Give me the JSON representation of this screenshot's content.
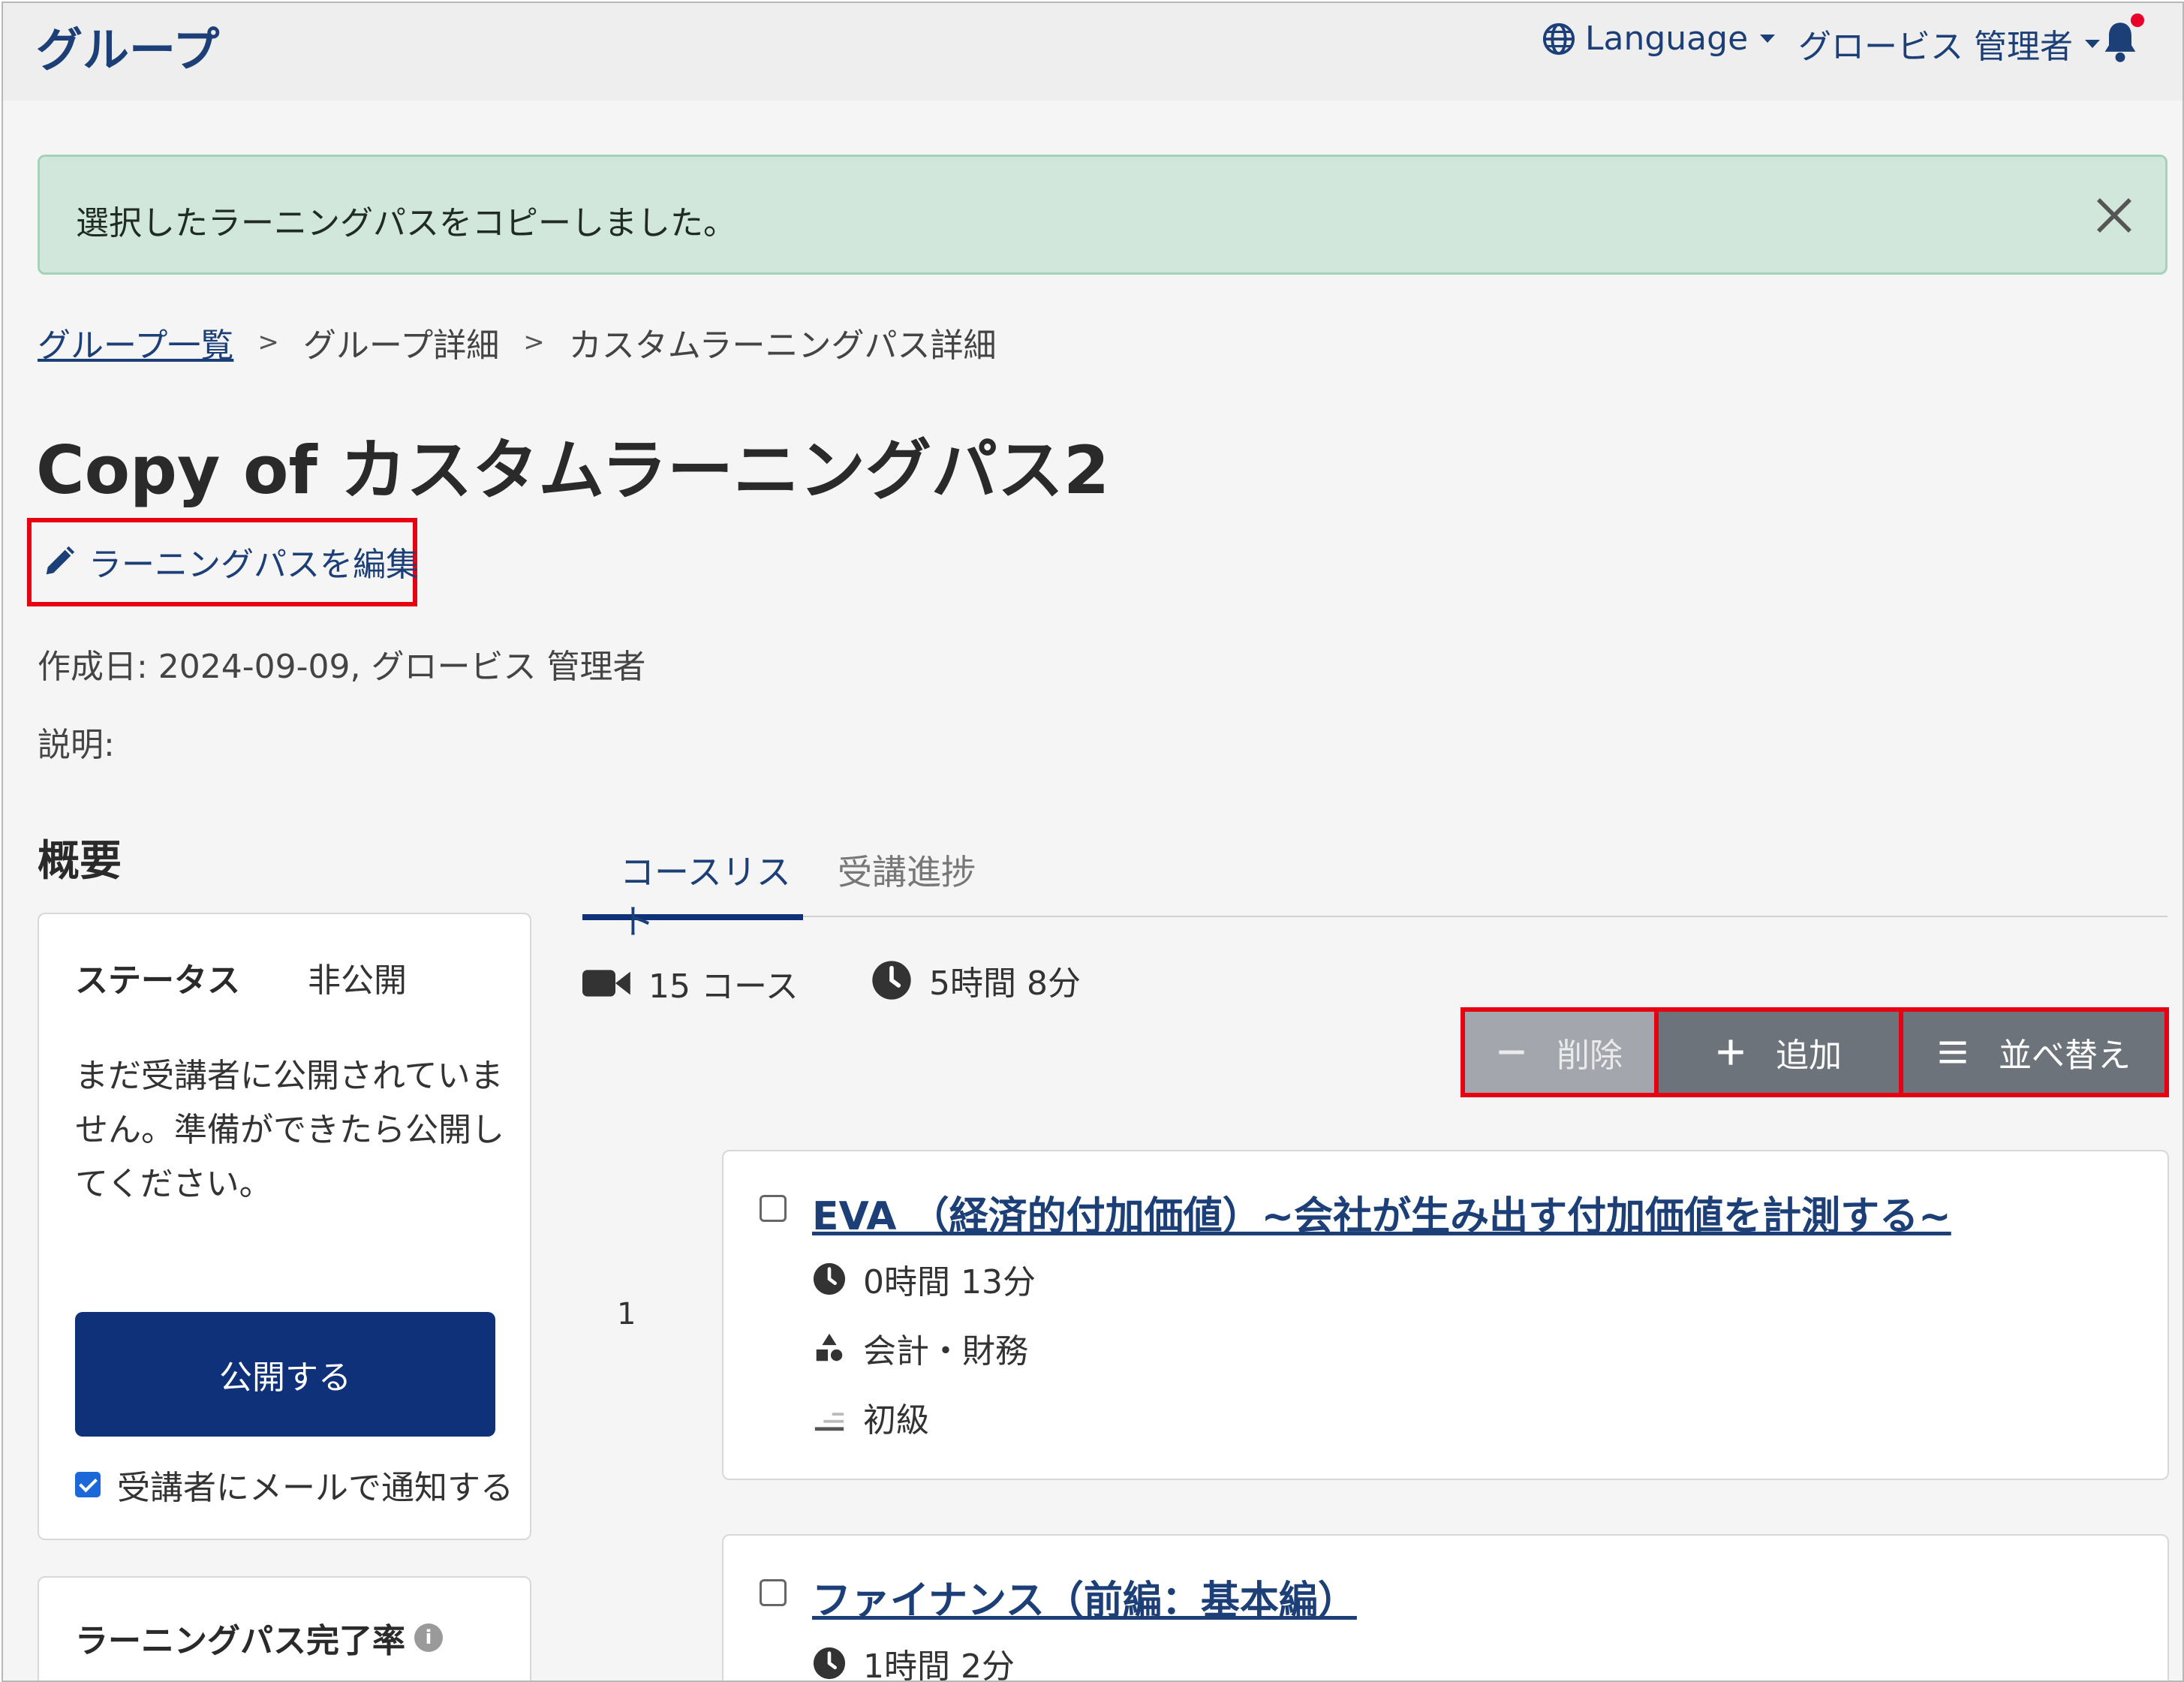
{
  "header": {
    "app_title": "グループ",
    "language_label": "Language",
    "user_label": "グロービス 管理者"
  },
  "alert": {
    "message": "選択したラーニングパスをコピーしました。"
  },
  "breadcrumb": {
    "items": [
      "グループ一覧",
      "グループ詳細",
      "カスタムラーニングパス詳細"
    ],
    "separator": ">"
  },
  "page": {
    "title": "Copy of カスタムラーニングパス2",
    "edit_label": "ラーニングパスを編集",
    "meta": "作成日: 2024-09-09, グロービス 管理者",
    "description_label": "説明:"
  },
  "overview": {
    "title": "概要",
    "status_label": "ステータス",
    "status_value": "非公開",
    "status_message": "まだ受講者に公開されていません。準備ができたら公開してください。",
    "publish_button": "公開する",
    "notify_label": "受講者にメールで通知する",
    "notify_checked": true,
    "completion_label": "ラーニングパス完了率"
  },
  "tabs": [
    {
      "label": "コースリスト",
      "active": true
    },
    {
      "label": "受講進捗",
      "active": false
    }
  ],
  "summary": {
    "course_count": "15 コース",
    "total_duration": "5時間 8分"
  },
  "toolbar": {
    "delete_label": "削除",
    "add_label": "追加",
    "sort_label": "並べ替え"
  },
  "courses": [
    {
      "index": "1",
      "title": "EVA （経済的付加価値）~会社が生み出す付加価値を計測する~",
      "duration": "0時間 13分",
      "category": "会計・財務",
      "level": "初級"
    },
    {
      "title": "ファイナンス（前編：基本編）",
      "duration": "1時間 2分"
    }
  ],
  "colors": {
    "brand": "#0f317a",
    "link": "#1c3f77",
    "alert_bg": "#d2e7dc",
    "highlight": "#e60012"
  }
}
